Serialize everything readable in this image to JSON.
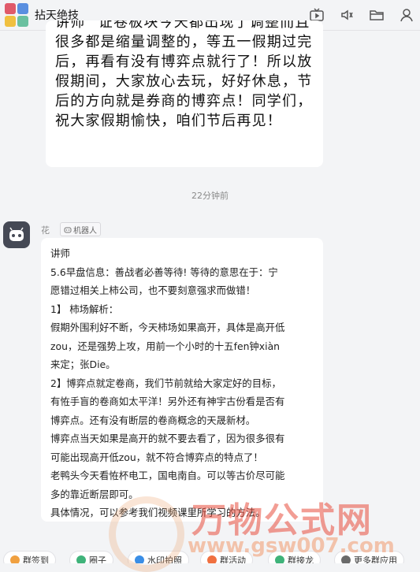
{
  "header": {
    "title": "拈天绝技",
    "icons": [
      "tv-icon",
      "speaker-icon",
      "folder-icon",
      "user-icon"
    ]
  },
  "prev_message": {
    "text": "讲师 \"证卷板块今天都出现了调整而且很多都是缩量调整的，等五一假期过完后，再看有没有博弈点就行了！所以放假期间，大家放心去玩，好好休息，节后的方向就是券商的博弈点！同学们，祝大家假期愉快，咱们节后再见！"
  },
  "timestamp": "22分钟前",
  "sender": {
    "name": "花",
    "badge": "机器人"
  },
  "message_lines": [
    "讲师",
    "5.6早盘信息：善战者必善等待! 等待的意思在于：宁",
    "愿错过相关上柿公司，也不要刻意强求而做错！",
    "1】 柿场解析：",
    "假期外围利好不断，今天柿场如果高开，具体是高开低",
    "zou，还是强势上攻，用前一个小时的十五fen钟xiàn",
    "来定；张Die。",
    "2】博弈点就定卷商，我们节前就给大家定好的目标，",
    "有恠手盲的卷商如太平洋！另外还有神宇古份看是否有",
    "博弈点。还有没有断层的卷商概念的天晟新材。",
    "博弈点当天如果是高开的就不要去看了，因为很多很有",
    "可能出现高开低zou，就不符合博弈点的特点了！",
    "老鸭头今天看恠杯电工，国电南自。可以等古价尽可能",
    "多的靠近断层即可。",
    "具体情况，可以参考我们视频课里所学习的方法。"
  ],
  "watermark": {
    "logo": "万物公式网",
    "url": "www.gsw007.com"
  },
  "toolbar": {
    "items": [
      {
        "label": "群签到",
        "icon": "checkin-icon",
        "color": "#f0a040"
      },
      {
        "label": "圈子",
        "icon": "circle-icon",
        "color": "#3fb37a"
      },
      {
        "label": "水印拍照",
        "icon": "camera-icon",
        "color": "#3a8ee6"
      },
      {
        "label": "群活动",
        "icon": "activity-icon",
        "color": "#f07040"
      },
      {
        "label": "群接龙",
        "icon": "chain-icon",
        "color": "#3fb37a"
      },
      {
        "label": "更多群应用",
        "icon": "apps-icon",
        "color": "#6a6a6a"
      }
    ]
  }
}
